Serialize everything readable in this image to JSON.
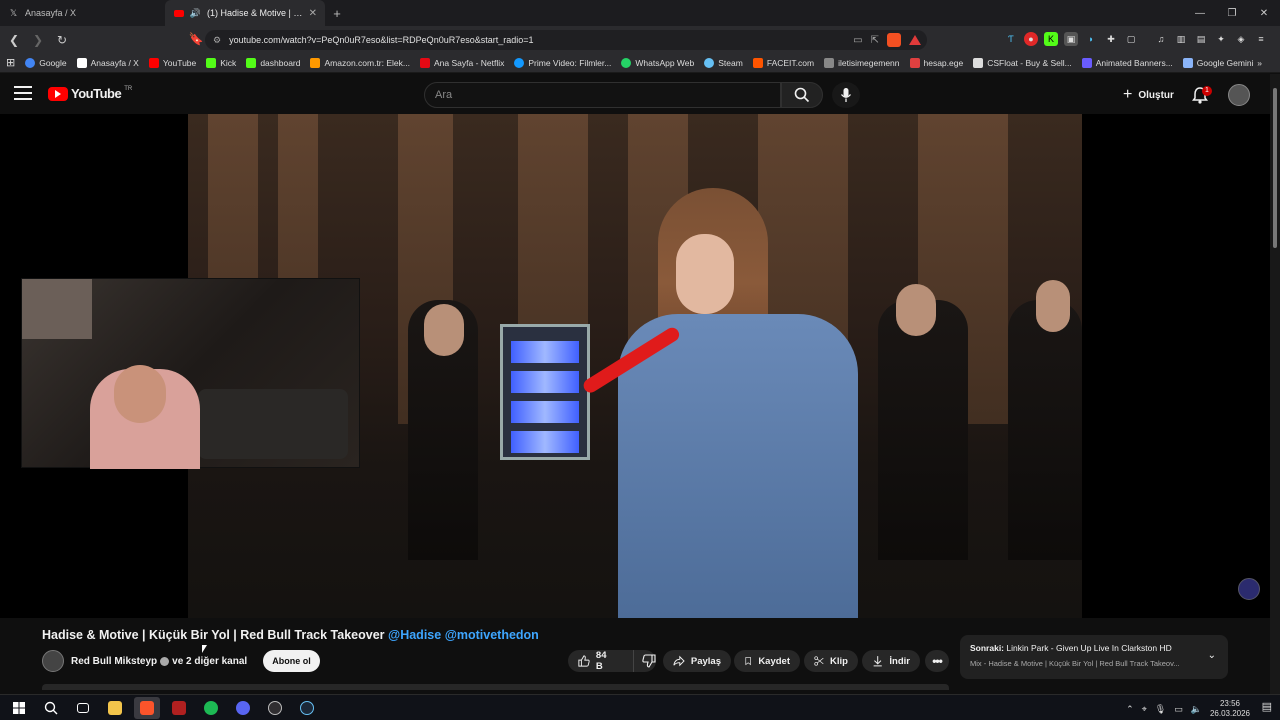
{
  "browser": {
    "tabs": [
      {
        "title": "Anasayfa / X",
        "icon": "x-icon"
      },
      {
        "title": "(1) Hadise & Motive | Küçük Bir Yol",
        "icon": "youtube-icon"
      }
    ],
    "url": "youtube.com/watch?v=PeQn0uR7eso&list=RDPeQn0uR7eso&start_radio=1",
    "bookmarks": [
      {
        "label": "Google",
        "color": "#4285f4"
      },
      {
        "label": "Anasayfa / X",
        "color": "#ffffff"
      },
      {
        "label": "YouTube",
        "color": "#ff0000"
      },
      {
        "label": "Kick",
        "color": "#53fc18"
      },
      {
        "label": "dashboard",
        "color": "#53fc18"
      },
      {
        "label": "Amazon.com.tr: Elek...",
        "color": "#ff9900"
      },
      {
        "label": "Ana Sayfa - Netflix",
        "color": "#e50914"
      },
      {
        "label": "Prime Video: Filmler...",
        "color": "#1399ff"
      },
      {
        "label": "WhatsApp Web",
        "color": "#25d366"
      },
      {
        "label": "Steam",
        "color": "#66c0f4"
      },
      {
        "label": "FACEIT.com",
        "color": "#ff5500"
      },
      {
        "label": "iletisimegemenn",
        "color": "#888888"
      },
      {
        "label": "hesap.ege",
        "color": "#e04040"
      },
      {
        "label": "CSFloat - Buy & Sell...",
        "color": "#dddddd"
      },
      {
        "label": "Animated Banners...",
        "color": "#6a5cff"
      },
      {
        "label": "Google Gemini",
        "color": "#8ab4f8"
      }
    ]
  },
  "youtube": {
    "logo_text": "YouTube",
    "country_code": "TR",
    "search_placeholder": "Ara",
    "create_label": "Oluştur",
    "notification_count": "1"
  },
  "video": {
    "title": "Hadise & Motive | Küçük Bir Yol | Red Bull Track Takeover",
    "tags": [
      "@Hadise",
      "@motivethedon"
    ],
    "channel": "Red Bull Miksteyp",
    "channel_suffix": "ve 2 diğer kanal",
    "subscribe_label": "Abone ol",
    "likes": "84 B",
    "share_label": "Paylaş",
    "save_label": "Kaydet",
    "clip_label": "Klip",
    "download_label": "İndir"
  },
  "up_next": {
    "label": "Sonraki:",
    "title": "Linkin Park - Given Up Live In Clarkston HD",
    "mix": "Mix - Hadise & Motive | Küçük Bir Yol | Red Bull Track Takeov..."
  },
  "taskbar": {
    "time": "23:56",
    "date": "26.03.2026"
  },
  "colors": {
    "accent_red": "#ff0000",
    "link_blue": "#3ea6ff",
    "background": "#0f0f0f"
  }
}
